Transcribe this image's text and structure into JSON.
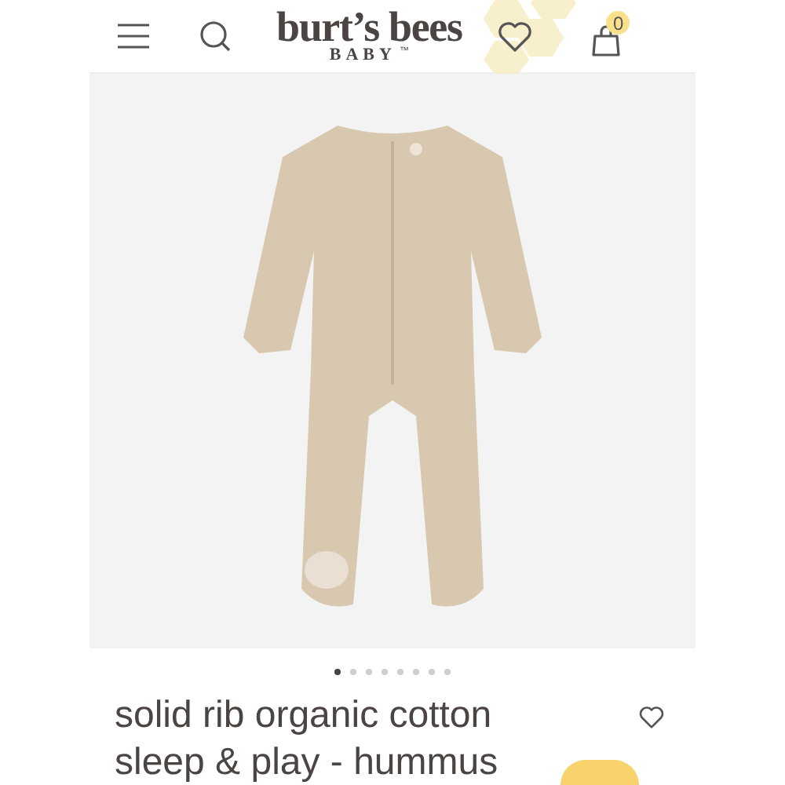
{
  "header": {
    "logo": {
      "name": "burt’s bees",
      "sub": "BABY",
      "mark": "™"
    },
    "cart_count": "0"
  },
  "gallery": {
    "dots": [
      {
        "selected": true
      },
      {
        "selected": false
      },
      {
        "selected": false
      },
      {
        "selected": false
      },
      {
        "selected": false
      },
      {
        "selected": false
      },
      {
        "selected": false
      },
      {
        "selected": false
      }
    ]
  },
  "product": {
    "title": "solid rib organic cotton sleep & play - hummus"
  }
}
